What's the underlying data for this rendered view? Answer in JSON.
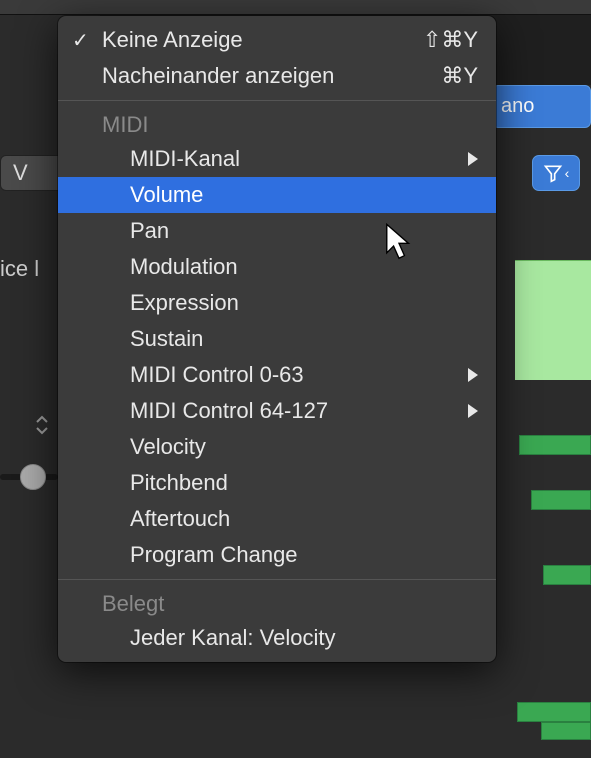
{
  "background": {
    "region_label": "ano",
    "button_v": "V",
    "left_partial_text": "ice l"
  },
  "menu": {
    "top": [
      {
        "label": "Keine Anzeige",
        "shortcut": "⇧⌘Y",
        "checked": true
      },
      {
        "label": "Nacheinander anzeigen",
        "shortcut": "⌘Y",
        "checked": false
      }
    ],
    "midi_header": "MIDI",
    "midi_items": [
      {
        "label": "MIDI-Kanal",
        "submenu": true,
        "selected": false
      },
      {
        "label": "Volume",
        "submenu": false,
        "selected": true
      },
      {
        "label": "Pan",
        "submenu": false,
        "selected": false
      },
      {
        "label": "Modulation",
        "submenu": false,
        "selected": false
      },
      {
        "label": "Expression",
        "submenu": false,
        "selected": false
      },
      {
        "label": "Sustain",
        "submenu": false,
        "selected": false
      },
      {
        "label": "MIDI Control 0-63",
        "submenu": true,
        "selected": false
      },
      {
        "label": "MIDI Control 64-127",
        "submenu": true,
        "selected": false
      },
      {
        "label": "Velocity",
        "submenu": false,
        "selected": false
      },
      {
        "label": "Pitchbend",
        "submenu": false,
        "selected": false
      },
      {
        "label": "Aftertouch",
        "submenu": false,
        "selected": false
      },
      {
        "label": "Program Change",
        "submenu": false,
        "selected": false
      }
    ],
    "used_header": "Belegt",
    "used_items": [
      {
        "label": "Jeder Kanal: Velocity"
      }
    ]
  }
}
